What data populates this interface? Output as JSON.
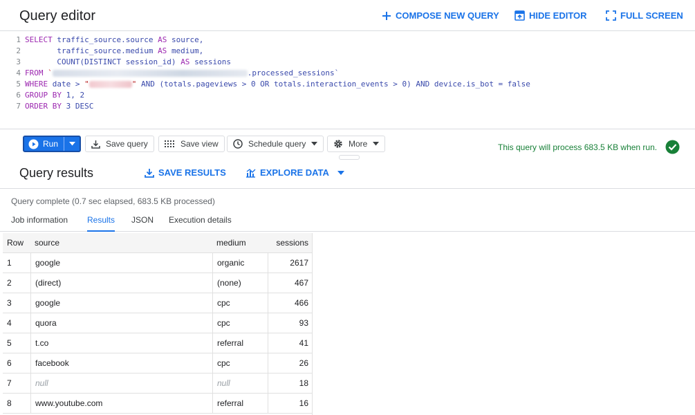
{
  "editor": {
    "title": "Query editor",
    "compose_label": "COMPOSE NEW QUERY",
    "hide_label": "HIDE EDITOR",
    "fullscreen_label": "FULL SCREEN"
  },
  "code": {
    "line_numbers": [
      "1",
      "2",
      "3",
      "4",
      "5",
      "6",
      "7"
    ],
    "l1_kw1": "SELECT",
    "l1_id": "traffic_source.source",
    "l1_kw2": "AS",
    "l1_id2": "source,",
    "l2_id": "traffic_source.medium",
    "l2_kw": "AS",
    "l2_id2": "medium,",
    "l3_fn": "COUNT(DISTINCT",
    "l3_id": "session_id)",
    "l3_kw": "AS",
    "l3_id2": "sessions",
    "l4_kw": "FROM",
    "l4_tick": "`",
    "l4_table": ".processed_sessions`",
    "l5_kw": "WHERE",
    "l5_a": "date >",
    "l5_q1": "\"",
    "l5_q2": "\"",
    "l5_b": "AND (totals.pageviews > 0 OR totals.interaction_events > 0) AND device.is_bot = false",
    "l6_kw": "GROUP BY",
    "l6_rest": "1, 2",
    "l7_kw": "ORDER BY",
    "l7_rest": "3 DESC"
  },
  "toolbar": {
    "run_label": "Run",
    "save_query_label": "Save query",
    "save_view_label": "Save view",
    "schedule_label": "Schedule query",
    "more_label": "More",
    "process_message": "This query will process 683.5 KB when run.",
    "status_color": "#188038"
  },
  "results": {
    "title": "Query results",
    "save_label": "SAVE RESULTS",
    "explore_label": "EXPLORE DATA",
    "status": "Query complete (0.7 sec elapsed, 683.5 KB processed)",
    "tabs": [
      "Job information",
      "Results",
      "JSON",
      "Execution details"
    ],
    "active_tab": "Results"
  },
  "table": {
    "headers": [
      "Row",
      "source",
      "medium",
      "sessions"
    ],
    "rows": [
      [
        "1",
        "google",
        "organic",
        "2617"
      ],
      [
        "2",
        "(direct)",
        "(none)",
        "467"
      ],
      [
        "3",
        "google",
        "cpc",
        "466"
      ],
      [
        "4",
        "quora",
        "cpc",
        "93"
      ],
      [
        "5",
        "t.co",
        "referral",
        "41"
      ],
      [
        "6",
        "facebook",
        "cpc",
        "26"
      ],
      [
        "7",
        "null",
        "null",
        "18"
      ],
      [
        "8",
        "www.youtube.com",
        "referral",
        "16"
      ]
    ]
  },
  "colors": {
    "accent": "#1a73e8",
    "success": "#188038"
  }
}
